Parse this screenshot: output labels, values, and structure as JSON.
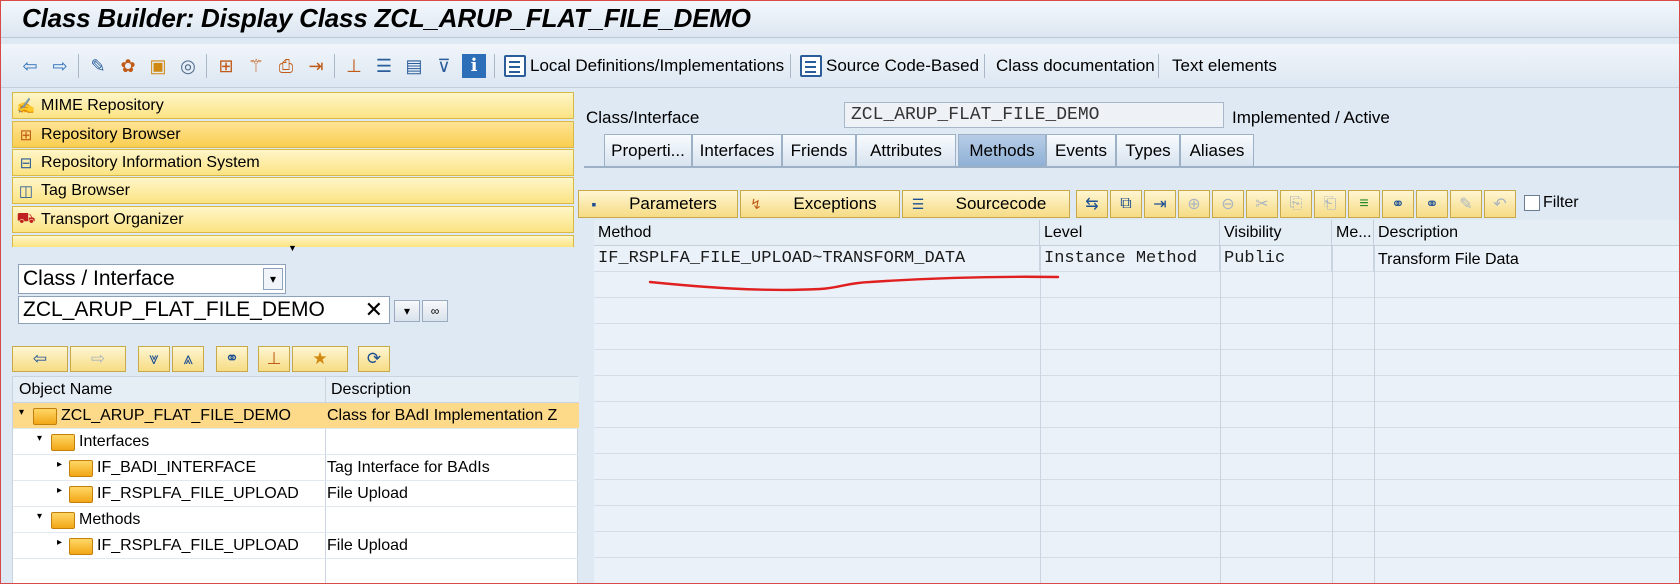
{
  "window": {
    "title": "Class Builder: Display Class ZCL_ARUP_FLAT_FILE_DEMO"
  },
  "toolbar": {
    "local_defs_label": "Local Definitions/Implementations",
    "source_code_label": "Source Code-Based",
    "class_doc_label": "Class documentation",
    "text_elements_label": "Text elements",
    "icons": [
      "back-icon",
      "forward-icon",
      "display-change-icon",
      "active-inactive-icon",
      "other-object-icon",
      "where-used-icon",
      "hierarchy-icon",
      "wand-icon",
      "print-icon",
      "export-icon",
      "tree-icon",
      "object-list-icon",
      "table-icon",
      "filter-icon",
      "info-icon"
    ]
  },
  "nav": {
    "items": [
      {
        "label": "MIME Repository",
        "icon": "mime-icon"
      },
      {
        "label": "Repository Browser",
        "icon": "repository-browser-icon"
      },
      {
        "label": "Repository Information System",
        "icon": "info-system-icon"
      },
      {
        "label": "Tag Browser",
        "icon": "tag-browser-icon"
      },
      {
        "label": "Transport Organizer",
        "icon": "transport-icon"
      }
    ],
    "object_type": "Class / Interface",
    "object_name": "ZCL_ARUP_FLAT_FILE_DEMO"
  },
  "tree": {
    "columns": [
      "Object Name",
      "Description"
    ],
    "rows": [
      {
        "name": "ZCL_ARUP_FLAT_FILE_DEMO",
        "desc": "Class for BAdI Implementation Z",
        "selected": true
      },
      {
        "name": "Interfaces",
        "desc": ""
      },
      {
        "name": "IF_BADI_INTERFACE",
        "desc": "Tag Interface for BAdIs"
      },
      {
        "name": "IF_RSPLFA_FILE_UPLOAD",
        "desc": "File Upload"
      },
      {
        "name": "Methods",
        "desc": ""
      },
      {
        "name": "IF_RSPLFA_FILE_UPLOAD",
        "desc": "File Upload"
      }
    ]
  },
  "class_info": {
    "label": "Class/Interface",
    "value": "ZCL_ARUP_FLAT_FILE_DEMO",
    "status": "Implemented / Active"
  },
  "tabs": [
    "Properti...",
    "Interfaces",
    "Friends",
    "Attributes",
    "Methods",
    "Events",
    "Types",
    "Aliases"
  ],
  "active_tab": "Methods",
  "method_toolbar": {
    "parameters_label": "Parameters",
    "exceptions_label": "Exceptions",
    "sourcecode_label": "Sourcecode",
    "filter_label": "Filter"
  },
  "grid": {
    "columns": [
      "Method",
      "Level",
      "Visibility",
      "Me...",
      "Description"
    ],
    "rows": [
      {
        "method": "IF_RSPLFA_FILE_UPLOAD~TRANSFORM_DATA",
        "level": "Instance Method",
        "visibility": "Public",
        "me": "",
        "description": "Transform File Data"
      }
    ]
  },
  "colors": {
    "accent": "#8fb0d6",
    "nav_yellow": "#fbe382",
    "selection": "#fdd98a",
    "annotation": "#e02020"
  }
}
